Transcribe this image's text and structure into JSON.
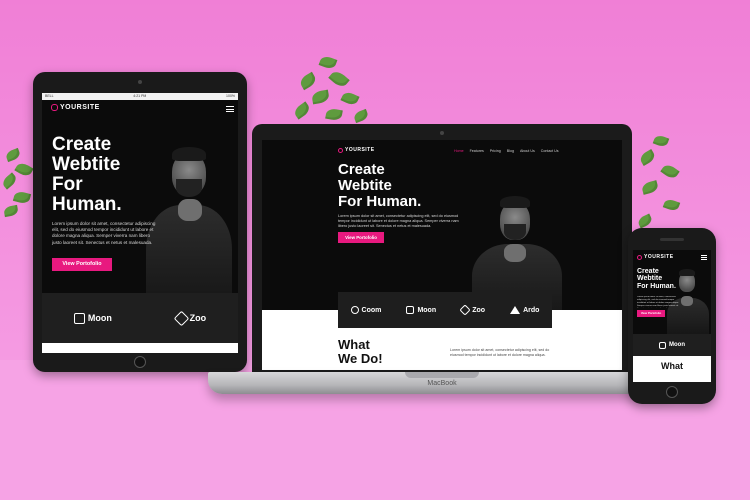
{
  "brand": {
    "name": "YOURSITE",
    "accent": "#e8197f",
    "background": "#f07fd6"
  },
  "site": {
    "headline": {
      "line1": "Create",
      "line2": "Webtite",
      "line3": "For Human."
    },
    "tablet_headline": {
      "line1": "Create",
      "line2": "Webtite",
      "line3": "For",
      "line4": "Human."
    },
    "paragraph": "Lorem ipsum dolor sit amet, consectetur adipiscing elit, sed do eiusmod tempor incididunt ut labore et dolore magna aliqua. Semper viverra nam libero justo laoreet sit. Senectus et netus et malesuada.",
    "cta": "View Portofolio",
    "nav": [
      "Home",
      "Features",
      "Pricing",
      "Blog",
      "About Us",
      "Contact Us"
    ],
    "brands": [
      "Coom",
      "Moon",
      "Zoo",
      "Ardo"
    ],
    "section_title": {
      "line1": "What",
      "line2": "We Do!"
    },
    "section_text": "Lorem ipsum dolor sit amet, consectetur adipiscing elit, sed do eiusmod tempor incididunt ut labore et dolore magna aliqua."
  },
  "devices": {
    "laptop_label": "MacBook",
    "tablet_status": {
      "carrier": "BELL",
      "time": "4:21 PM",
      "battery": "100%"
    },
    "phone_section": "What"
  },
  "icons": [
    "hamburger-menu-icon",
    "logo-mark-icon",
    "coom-icon",
    "moon-icon",
    "zoo-icon",
    "ardo-icon"
  ]
}
